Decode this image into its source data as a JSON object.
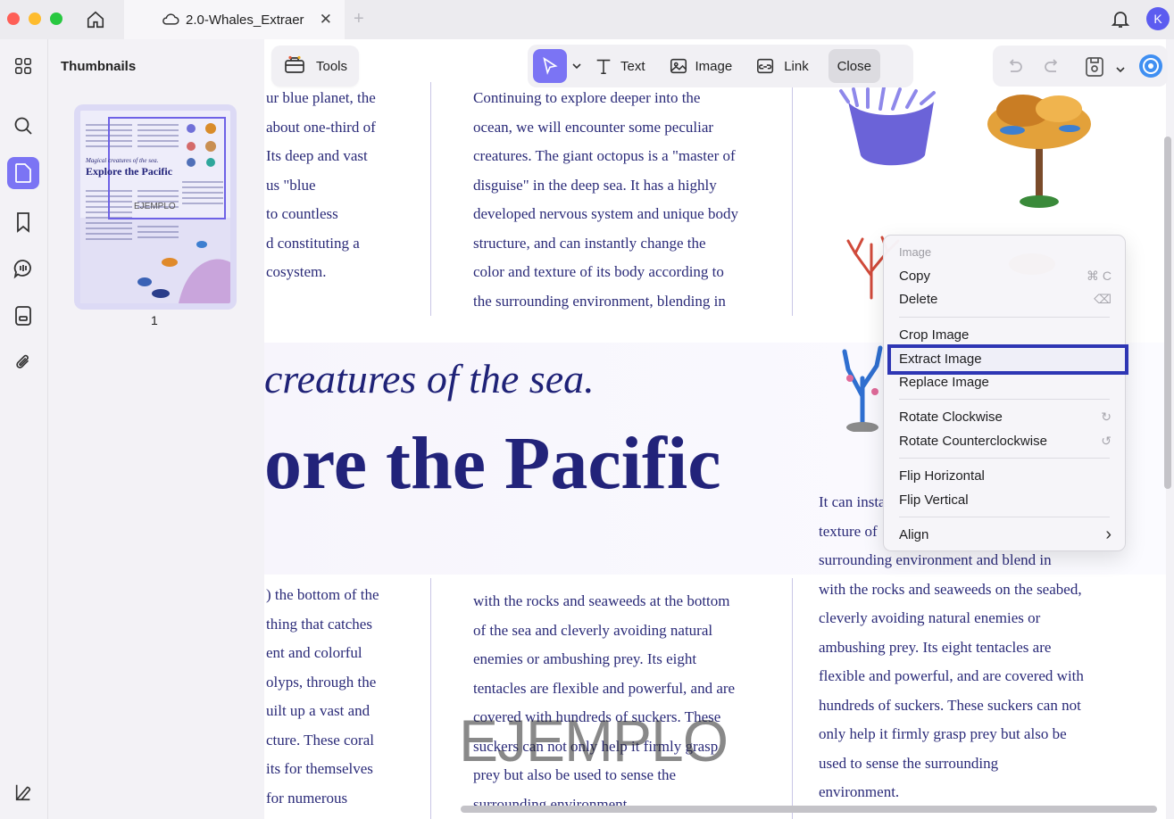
{
  "titlebar": {
    "tab_title": "2.0-Whales_Extraer",
    "tab_close": "✕",
    "tab_add": "+",
    "avatar_letter": "K"
  },
  "sidebar": {
    "panel_title": "Thumbnails",
    "page_number": "1",
    "icons": [
      "thumbnails-grid-icon",
      "search-icon",
      "page-icon",
      "bookmark-icon",
      "comment-icon",
      "form-icon",
      "attachment-icon"
    ],
    "bottom_icon": "layout-toggle-icon"
  },
  "thumbnail": {
    "subtitle": "Magical creatures of the sea.",
    "headline": "Explore the Pacific",
    "watermark": "EJEMPLO"
  },
  "toolbar": {
    "tools_label": "Tools",
    "text_label": "Text",
    "image_label": "Image",
    "link_label": "Link",
    "close_label": "Close"
  },
  "document": {
    "col1_top": [
      "ur blue planet, the",
      "about one-third of",
      "Its deep and vast",
      "us \"blue",
      "to countless",
      "d constituting a",
      "cosystem."
    ],
    "col2_top": [
      "Continuing to explore deeper into the",
      "ocean, we will encounter some peculiar",
      "creatures. The giant octopus is a \"master of",
      "disguise\" in the deep sea. It has a highly",
      "developed nervous system and unique body",
      "structure, and can instantly change the",
      "color and texture of its body according to",
      "the surrounding environment, blending in"
    ],
    "subtitle": "creatures of the sea.",
    "headline": "ore the Pacific",
    "col1_bottom": [
      ") the bottom of the",
      "thing that catches",
      "ent and colorful",
      "olyps, through the",
      "uilt up a vast and",
      "cture. These coral",
      "its for themselves",
      "for numerous"
    ],
    "col2_bottom": [
      "with the rocks and seaweeds at the bottom",
      "of the sea and cleverly avoiding natural",
      "enemies or ambushing prey. Its eight",
      "tentacles are flexible and powerful, and are",
      "covered with hundreds of suckers. These",
      "suckers can not only help it firmly grasp",
      "prey but also be used to sense the",
      "surrounding environment."
    ],
    "col3_bottom": [
      "It can insta",
      "texture of",
      "surrounding environment and blend in",
      "with the rocks and seaweeds on the seabed,",
      "cleverly avoiding natural enemies or",
      "ambushing prey. Its eight tentacles are",
      "flexible and powerful, and are covered with",
      "hundreds of suckers. These suckers can not",
      "only help it firmly grasp prey but also be",
      "used to sense the surrounding",
      "environment."
    ],
    "watermark": "EJEMPLO"
  },
  "context_menu": {
    "header": "Image",
    "copy": "Copy",
    "copy_shortcut": "⌘ C",
    "delete": "Delete",
    "delete_shortcut": "⌫",
    "crop": "Crop Image",
    "extract": "Extract Image",
    "replace": "Replace Image",
    "rotate_cw": "Rotate Clockwise",
    "rotate_cw_icon": "↻",
    "rotate_ccw": "Rotate Counterclockwise",
    "rotate_ccw_icon": "↺",
    "flip_h": "Flip Horizontal",
    "flip_v": "Flip Vertical",
    "align": "Align",
    "align_arrow": "›"
  },
  "colors": {
    "accent": "#7b74f4",
    "highlight_border": "#2e36b4",
    "text_navy": "#22237a"
  }
}
